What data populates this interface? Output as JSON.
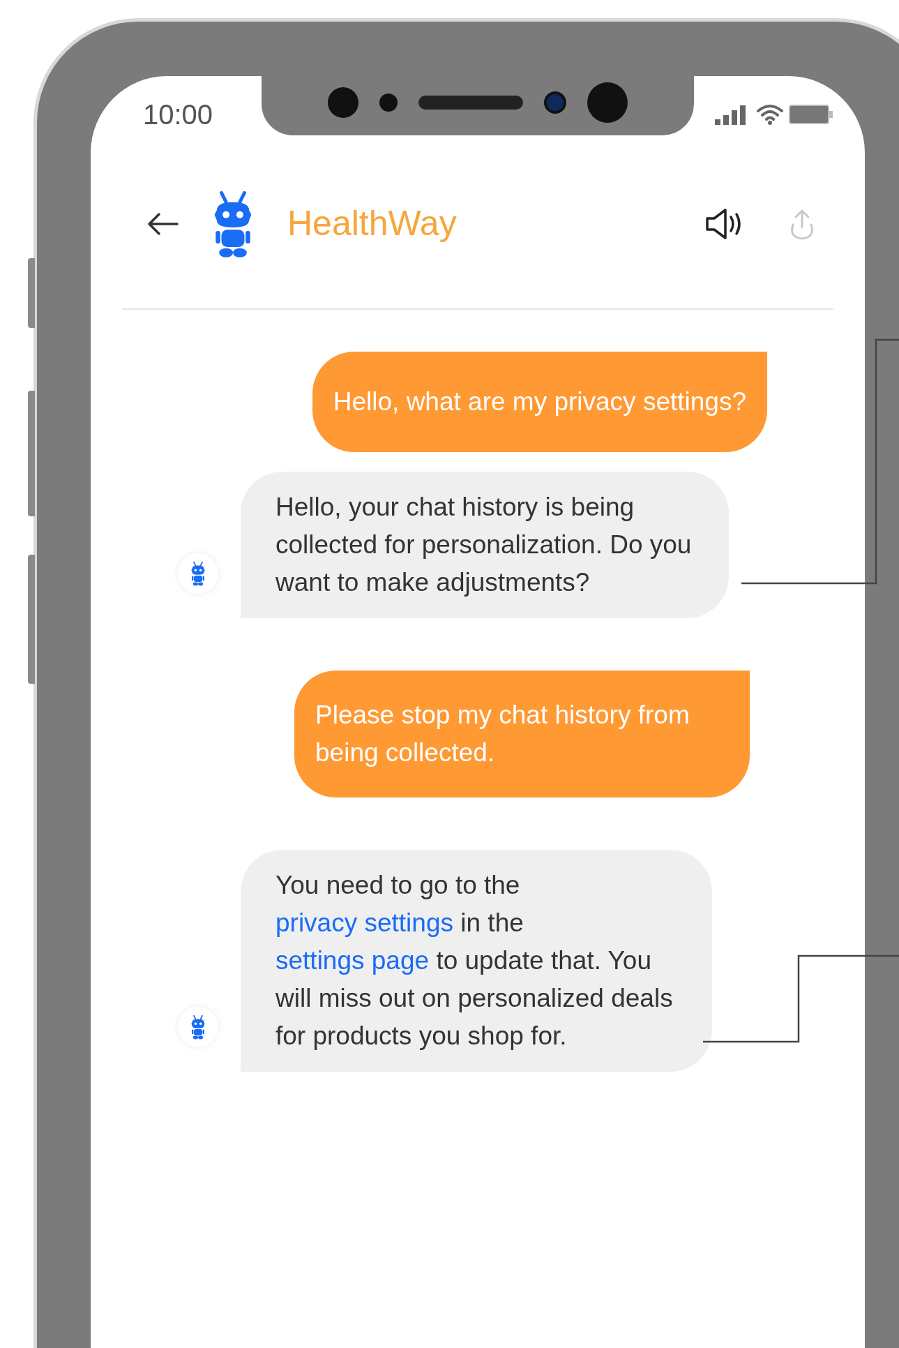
{
  "status_bar": {
    "time": "10:00"
  },
  "header": {
    "title": "HealthWay"
  },
  "messages": [
    {
      "kind": "user",
      "segments": [
        {
          "kind": "text",
          "text": "Hello, what are my privacy settings?"
        }
      ]
    },
    {
      "kind": "bot",
      "segments": [
        {
          "kind": "text",
          "text": "Hello, your chat history is being collected for personalization. Do you want to make adjustments?"
        }
      ]
    },
    {
      "kind": "user",
      "segments": [
        {
          "kind": "text",
          "text": "Please stop my chat history from being collected."
        }
      ]
    },
    {
      "kind": "bot",
      "segments": [
        {
          "kind": "text",
          "text": "You need to go to the "
        },
        {
          "kind": "link",
          "text": "privacy settings"
        },
        {
          "kind": "text",
          "text": " in the "
        },
        {
          "kind": "link",
          "text": "settings page"
        },
        {
          "kind": "text",
          "text": " to update that. You will miss out on personalized deals for products you shop for."
        }
      ]
    }
  ]
}
